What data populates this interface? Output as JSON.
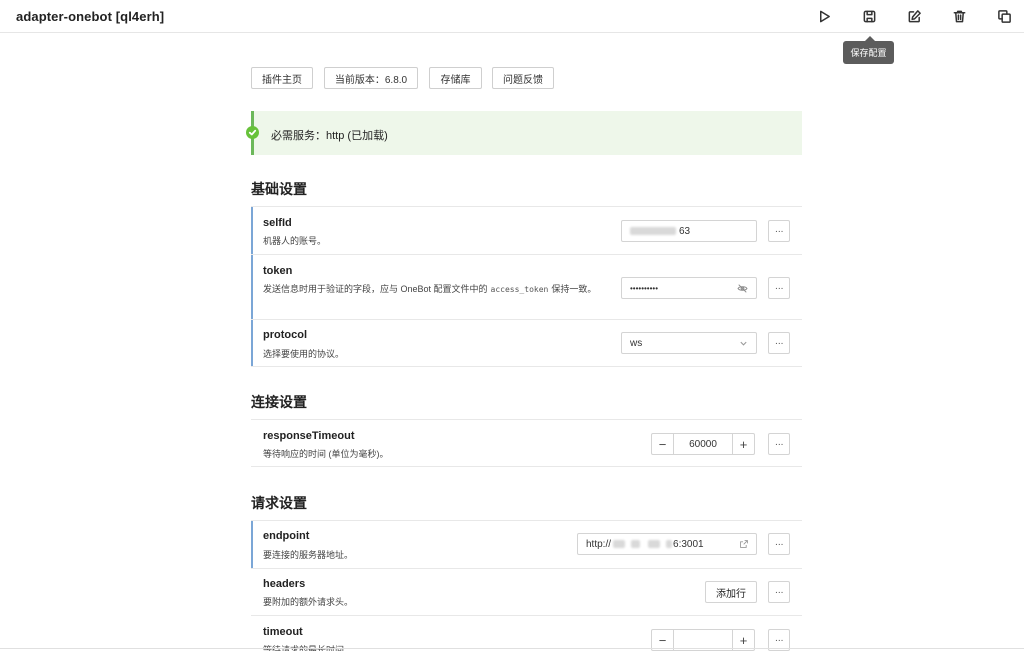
{
  "header": {
    "title": "adapter-onebot [ql4erh]",
    "tooltip": "保存配置",
    "icons": [
      "play-icon",
      "save-icon",
      "edit-icon",
      "trash-icon",
      "copy-icon"
    ]
  },
  "links": [
    {
      "label": "插件主页"
    },
    {
      "label": "当前版本：6.8.0"
    },
    {
      "label": "存储库"
    },
    {
      "label": "问题反馈"
    }
  ],
  "alert": {
    "text": "必需服务：http (已加载)",
    "color": "#67c23a"
  },
  "sections": {
    "basic": {
      "title": "基础设置",
      "selfId": {
        "name": "selfId",
        "desc": "机器人的账号。",
        "value_suffix": "63"
      },
      "token": {
        "name": "token",
        "desc_pre": "发送信息时用于验证的字段，应与 OneBot 配置文件中的",
        "desc_code": "access_token",
        "desc_post": "保持一致。",
        "value": "••••••••••"
      },
      "protocol": {
        "name": "protocol",
        "desc": "选择要使用的协议。",
        "value": "ws"
      }
    },
    "connection": {
      "title": "连接设置",
      "responseTimeout": {
        "name": "responseTimeout",
        "desc": "等待响应的时间 (单位为毫秒)。",
        "value": "60000"
      }
    },
    "request": {
      "title": "请求设置",
      "endpoint": {
        "name": "endpoint",
        "desc": "要连接的服务器地址。",
        "value_prefix": "http://",
        "value_suffix": "6:3001"
      },
      "headers": {
        "name": "headers",
        "desc": "要附加的额外请求头。",
        "button": "添加行"
      },
      "timeout": {
        "name": "timeout",
        "desc": "等待请求的最长时间。",
        "value": ""
      }
    }
  },
  "more_label": "···",
  "minus": "−",
  "plus": "+",
  "accent_color": "#7ba6d6"
}
